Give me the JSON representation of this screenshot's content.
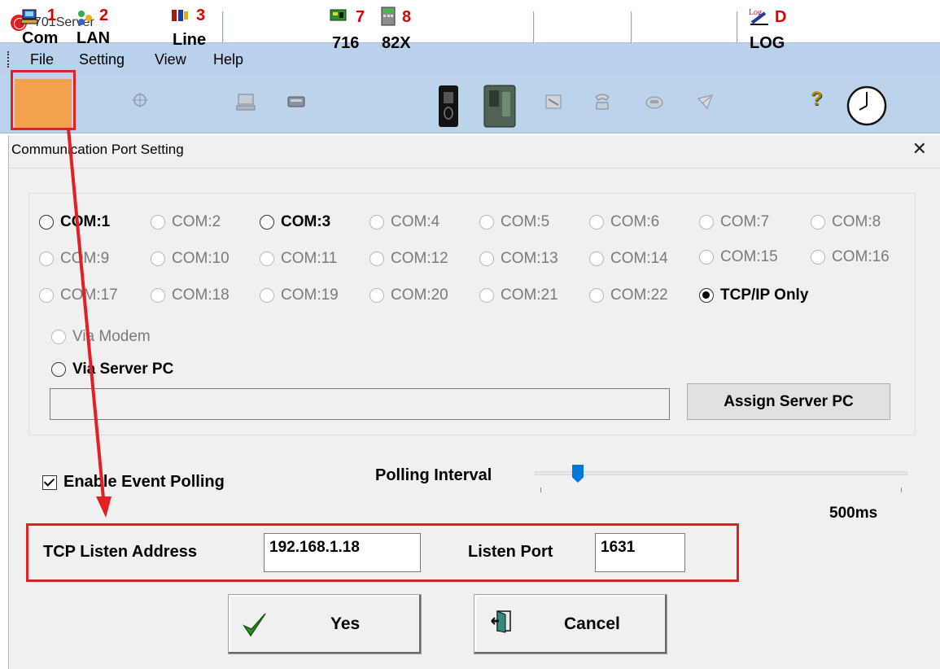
{
  "app": {
    "title": "701Server",
    "icon": "server-logo-icon"
  },
  "menu": [
    "File",
    "Setting",
    "View",
    "Help"
  ],
  "toolbar": {
    "com": {
      "num": "1",
      "label": "Com",
      "icon": "com-port-icon"
    },
    "lan": {
      "num": "2",
      "label": "LAN",
      "icon": "lan-icon"
    },
    "line": {
      "num": "3",
      "label": "Line",
      "icon": "line-icon"
    },
    "c716": {
      "num": "7",
      "label": "716",
      "icon": "controller-716-icon"
    },
    "c82x": {
      "num": "8",
      "label": "82X",
      "icon": "controller-82x-icon"
    },
    "log": {
      "num": "D",
      "label": "LOG",
      "icon": "log-icon"
    },
    "help_icon": "help-icon",
    "clock_icon": "clock-icon"
  },
  "dialog": {
    "title": "Communication Port Setting",
    "close_glyph": "✕",
    "com_ports": [
      [
        "COM:1",
        "COM:2",
        "COM:3",
        "COM:4",
        "COM:5",
        "COM:6",
        "COM:7",
        "COM:8"
      ],
      [
        "COM:9",
        "COM:10",
        "COM:11",
        "COM:12",
        "COM:13",
        "COM:14",
        "COM:15",
        "COM:16"
      ],
      [
        "COM:17",
        "COM:18",
        "COM:19",
        "COM:20",
        "COM:21",
        "COM:22",
        "TCP/IP Only"
      ]
    ],
    "selected": "TCP/IP Only",
    "via_modem": "Via Modem",
    "via_server": "Via Server PC",
    "server_pc_value": "",
    "assign_button": "Assign Server PC",
    "enable_polling": "Enable Event Polling",
    "enable_polling_checked": true,
    "polling_label": "Polling Interval",
    "polling_value": "500ms",
    "tcp_label": "TCP Listen Address",
    "tcp_value": "192.168.1.18",
    "port_label": "Listen Port",
    "port_value": "1631",
    "yes_button": "Yes",
    "cancel_button": "Cancel"
  },
  "colors": {
    "highlight": "#e31e24",
    "toolbar": "#bcd3ec",
    "menubar": "#b9d1ea",
    "num": "#e00000"
  }
}
